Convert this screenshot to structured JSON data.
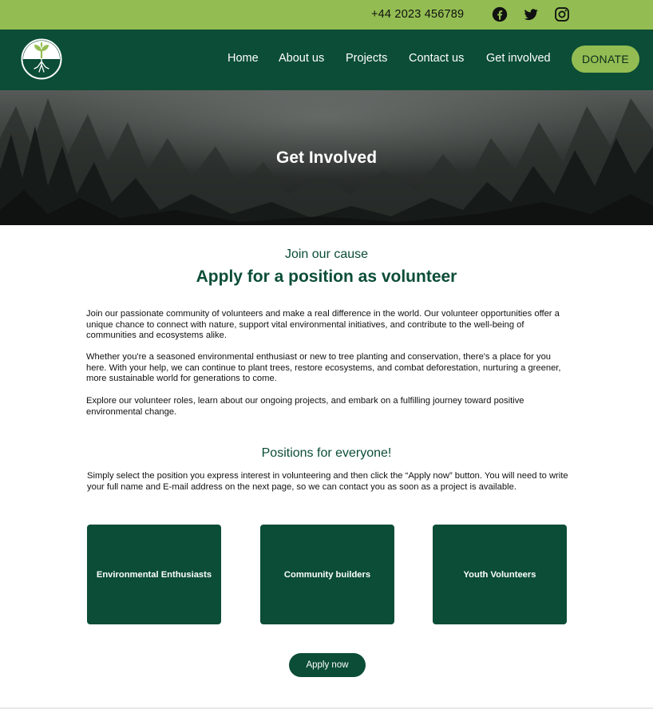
{
  "topbar": {
    "phone": "+44 2023 456789",
    "icons": [
      "facebook-icon",
      "twitter-icon",
      "instagram-icon"
    ]
  },
  "nav": {
    "logo": "tree-roots-logo",
    "items": [
      {
        "label": "Home"
      },
      {
        "label": "About us"
      },
      {
        "label": "Projects"
      },
      {
        "label": "Contact us"
      },
      {
        "label": "Get involved"
      }
    ],
    "donate_label": "DONATE"
  },
  "hero": {
    "title": "Get Involved"
  },
  "intro": {
    "kicker": "Join our cause",
    "heading": "Apply for a position as volunteer",
    "paragraphs": [
      "Join our passionate community of volunteers and make a real difference in the world. Our volunteer opportunities offer a unique chance to connect with nature, support vital environmental initiatives, and contribute to the well-being of communities and ecosystems alike.",
      "Whether you're a seasoned environmental enthusiast or new to tree planting and conservation, there's a place for you here. With your help, we can continue to plant trees, restore ecosystems, and combat deforestation, nurturing a greener, more sustainable world for generations to come.",
      "Explore our volunteer roles, learn about our ongoing projects, and embark on a fulfilling journey toward positive environmental change."
    ]
  },
  "positions": {
    "heading": "Positions for everyone!",
    "description": "Simply select the position you express interest in volunteering and then click the “Apply now” button. You will need to write your full name and E-mail address on the next page, so we can contact you as soon as a project is available.",
    "cards": [
      {
        "label": "Environmental Enthusiasts"
      },
      {
        "label": "Community builders"
      },
      {
        "label": "Youth Volunteers"
      }
    ],
    "apply_label": "Apply now"
  },
  "colors": {
    "topbar": "#93bd52",
    "brand_dark_green": "#0b4d36",
    "accent_light_green": "#93bd52"
  }
}
